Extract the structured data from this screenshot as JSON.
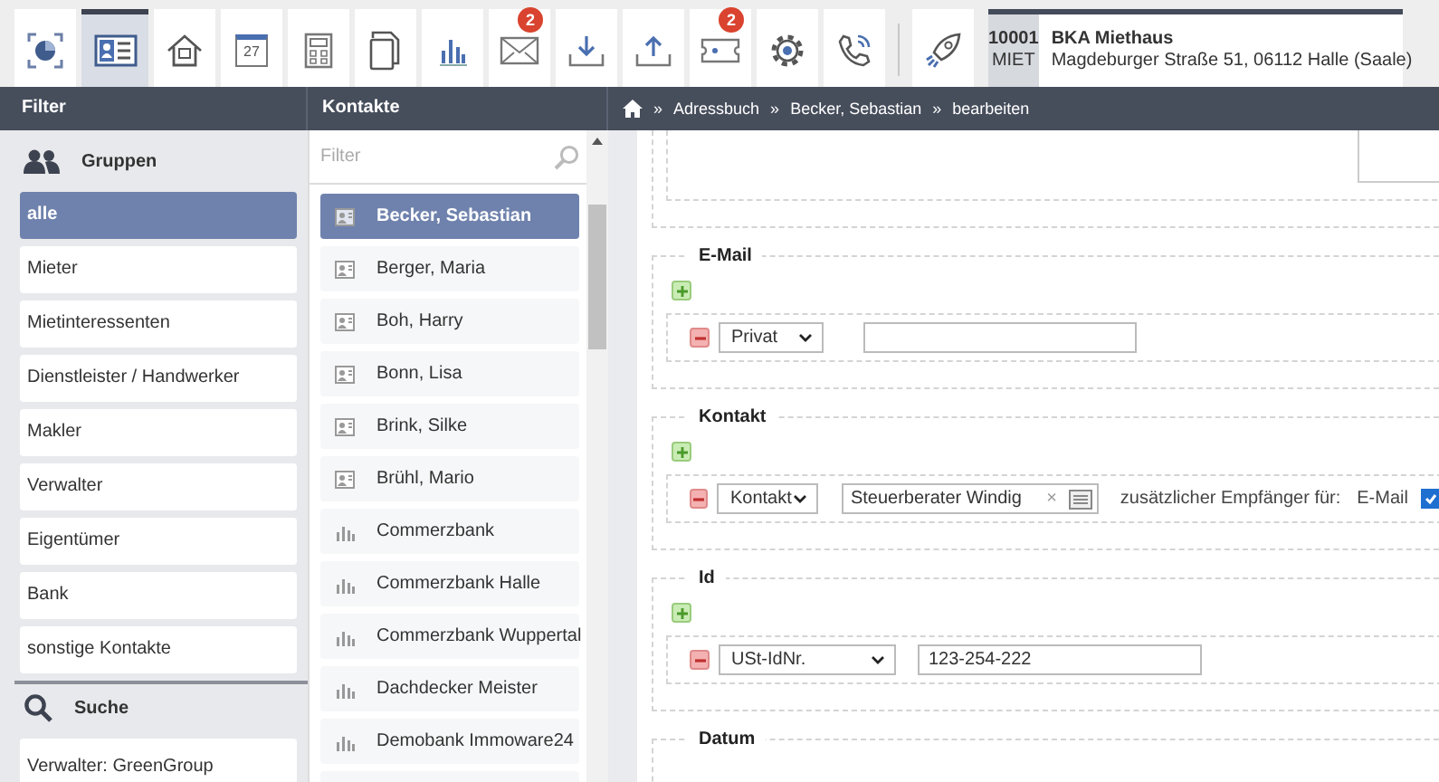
{
  "toolbar": {
    "tools": [
      {
        "kind": "dashboard",
        "selected": false
      },
      {
        "kind": "contacts",
        "selected": true
      },
      {
        "kind": "house",
        "selected": false
      },
      {
        "kind": "calendar",
        "selected": false,
        "label": "27"
      },
      {
        "kind": "calculator",
        "selected": false
      },
      {
        "kind": "documents",
        "selected": false
      },
      {
        "kind": "chart",
        "selected": false
      },
      {
        "kind": "mail",
        "selected": false,
        "badge": "2"
      },
      {
        "kind": "download",
        "selected": false
      },
      {
        "kind": "upload",
        "selected": false
      },
      {
        "kind": "ticket",
        "selected": false,
        "badge": "2"
      },
      {
        "kind": "gear",
        "selected": false
      },
      {
        "kind": "phone",
        "selected": false
      }
    ],
    "extra": [
      {
        "kind": "rocket",
        "selected": false
      }
    ]
  },
  "property": {
    "number": "10001",
    "type": "MIET",
    "name": "BKA Miethaus",
    "address": "Magdeburger Straße 51, 06112 Halle (Saale)"
  },
  "header": {
    "filter_title": "Filter",
    "contacts_title": "Kontakte",
    "breadcrumb": [
      {
        "sep": "»",
        "label": "Adressbuch"
      },
      {
        "sep": "»",
        "label": "Becker, Sebastian"
      },
      {
        "sep": "»",
        "label": "bearbeiten"
      }
    ]
  },
  "groups": {
    "title": "Gruppen",
    "items": [
      {
        "label": "alle",
        "selected": true
      },
      {
        "label": "Mieter",
        "selected": false
      },
      {
        "label": "Mietinteressenten",
        "selected": false
      },
      {
        "label": "Dienstleister / Handwerker",
        "selected": false
      },
      {
        "label": "Makler",
        "selected": false
      },
      {
        "label": "Verwalter",
        "selected": false
      },
      {
        "label": "Eigentümer",
        "selected": false
      },
      {
        "label": "Bank",
        "selected": false
      },
      {
        "label": "sonstige Kontakte",
        "selected": false
      }
    ]
  },
  "search": {
    "title": "Suche",
    "items": [
      "Verwalter: GreenGroup"
    ]
  },
  "contacts": {
    "filter_placeholder": "Filter",
    "items": [
      {
        "name": "Becker, Sebastian",
        "kind": "person",
        "selected": true
      },
      {
        "name": "Berger, Maria",
        "kind": "person",
        "selected": false
      },
      {
        "name": "Boh, Harry",
        "kind": "person",
        "selected": false
      },
      {
        "name": "Bonn, Lisa",
        "kind": "person",
        "selected": false
      },
      {
        "name": "Brink, Silke",
        "kind": "person",
        "selected": false
      },
      {
        "name": "Brühl, Mario",
        "kind": "person",
        "selected": false
      },
      {
        "name": "Commerzbank",
        "kind": "company",
        "selected": false
      },
      {
        "name": "Commerzbank Halle",
        "kind": "company",
        "selected": false
      },
      {
        "name": "Commerzbank Wuppertal",
        "kind": "company",
        "selected": false
      },
      {
        "name": "Dachdecker Meister",
        "kind": "company",
        "selected": false
      },
      {
        "name": "Demobank Immoware24",
        "kind": "company",
        "selected": false
      }
    ]
  },
  "form": {
    "sections": [
      {
        "title": "E-Mail",
        "rows": [
          {
            "kind": "plain",
            "type": "Privat"
          }
        ]
      },
      {
        "title": "Kontakt",
        "rows": [
          {
            "kind": "contact",
            "type": "Kontakt",
            "value": "Steuerberater Windig",
            "clear": "×",
            "extra_label": "zusätzlicher Empfänger für:",
            "check_label": "E-Mail",
            "checked": true
          }
        ]
      },
      {
        "title": "Id",
        "rows": [
          {
            "kind": "plain",
            "type": "USt-IdNr.",
            "value": "123-254-222",
            "wide": true
          }
        ]
      },
      {
        "title": "Datum"
      }
    ]
  }
}
